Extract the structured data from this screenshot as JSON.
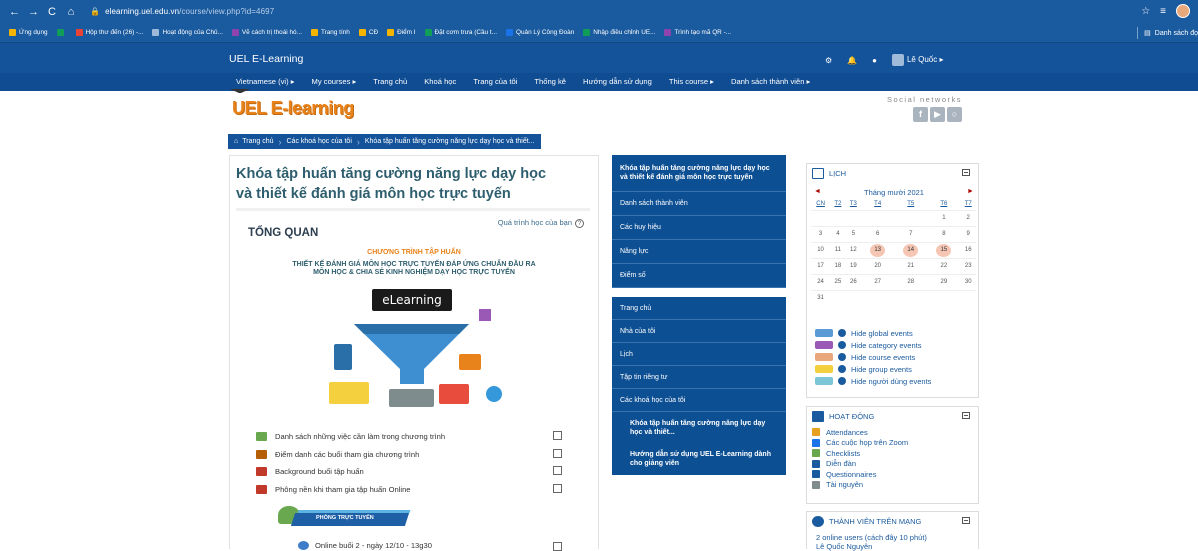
{
  "browser": {
    "url_host": "elearning.uel.edu.vn",
    "url_path": "/course/view.php?id=4697",
    "bookmarks": [
      {
        "label": "Ứng dụng",
        "color": "#f4b400"
      },
      {
        "label": "",
        "color": "#0f9d58"
      },
      {
        "label": "Hộp thư đến (26) -...",
        "color": "#ea4335"
      },
      {
        "label": "Hoạt động của Chủ...",
        "color": "#9fb9d8"
      },
      {
        "label": "Vẽ cách trị thoái hó...",
        "color": "#8e44ad"
      },
      {
        "label": "Trang tính",
        "color": "#f4b400"
      },
      {
        "label": "CĐ",
        "color": "#f4b400"
      },
      {
        "label": "Điểm I",
        "color": "#f4b400"
      },
      {
        "label": "Đặt cơm trưa (Cầu t...",
        "color": "#0f9d58"
      },
      {
        "label": "Quản Lý Công Đoàn",
        "color": "#1a73e8"
      },
      {
        "label": "Nhập điều chỉnh UE...",
        "color": "#0f9d58"
      },
      {
        "label": "Trình tạo mã QR -...",
        "color": "#8e44ad"
      }
    ],
    "bookmark_list_label": "Danh sách đọ"
  },
  "site": {
    "name": "UEL E-Learning",
    "user_name": "Lê Quốc",
    "menu": [
      "Vietnamese (vi) ▸",
      "My courses ▸",
      "Trang chủ",
      "Khoá học",
      "Trang của tôi",
      "Thống kê",
      "Hướng dẫn sử dụng",
      "This course ▸",
      "Danh sách thành viên ▸"
    ],
    "logo": "UEL E-learning",
    "social_label": "Social networks"
  },
  "breadcrumb": [
    "Trang chủ",
    "Các khoá học của tôi",
    "Khóa tập huấn tăng cường năng lực dạy học và thiết..."
  ],
  "course": {
    "title": "Khóa tập huấn tăng cường năng lực dạy học và thiết kế đánh giá môn học trực tuyến",
    "progress_label": "Quá trình học của bạn",
    "overview": "TỔNG QUAN",
    "program_title": "CHƯƠNG TRÌNH TẬP HUẤN",
    "program_sub_1": "THIẾT KẾ ĐÁNH GIÁ MÔN HỌC TRỰC TUYẾN ĐÁP ỨNG CHUẨN ĐẦU RA",
    "program_sub_2": "MÔN HỌC & CHIA SẺ KINH NGHIỆM DẠY HỌC TRỰC TUYẾN",
    "illus_label": "eLearning",
    "activities": [
      "Danh sách những việc cần làm trong chương trình",
      "Điểm danh các buổi tham gia chương trình",
      "Background buổi tập huấn",
      "Phông nền khi tham gia tập huấn Online"
    ],
    "live_banner": "PHÒNG TRỰC TUYẾN",
    "online_row": "Online buổi 2 - ngày 12/10 - 13g30"
  },
  "nav1": {
    "current": "Khóa tập huấn tăng cường năng lực dạy học và thiết kế đánh giá môn học trực tuyến",
    "items": [
      "Danh sách thành viên",
      "Các huy hiệu",
      "Năng lực",
      "Điểm số"
    ]
  },
  "nav2": {
    "items": [
      "Trang chủ",
      "Nhà của tôi",
      "Lịch",
      "Tập tin riêng tư",
      "Các khoá học của tôi"
    ],
    "sub_items": [
      "Khóa tập huấn tăng cường năng lực dạy học và thiết...",
      "Hướng dẫn sử dụng UEL E-Learning dành cho giảng viên"
    ]
  },
  "calendar": {
    "title": "LỊCH",
    "month": "Tháng mười 2021",
    "weekdays": [
      "CN",
      "T2",
      "T3",
      "T4",
      "T5",
      "T6",
      "T7"
    ],
    "weeks": [
      [
        "",
        "",
        "",
        "",
        "",
        "1",
        "2"
      ],
      [
        "3",
        "4",
        "5",
        "6",
        "7",
        "8",
        "9"
      ],
      [
        "10",
        "11",
        "12",
        "13",
        "14",
        "15",
        "16"
      ],
      [
        "17",
        "18",
        "19",
        "20",
        "21",
        "22",
        "23"
      ],
      [
        "24",
        "25",
        "26",
        "27",
        "28",
        "29",
        "30"
      ],
      [
        "31",
        "",
        "",
        "",
        "",
        "",
        ""
      ]
    ],
    "highlighted_days": [
      "13",
      "14",
      "15"
    ],
    "events": [
      {
        "label": "Hide global events",
        "color": "#5b9bd5"
      },
      {
        "label": "Hide category events",
        "color": "#9b59b6"
      },
      {
        "label": "Hide course events",
        "color": "#e8a87c"
      },
      {
        "label": "Hide group events",
        "color": "#f4d03f"
      },
      {
        "label": "Hide người dùng events",
        "color": "#7dc6d8"
      }
    ]
  },
  "activity_block": {
    "title": "HOẠT ĐỘNG",
    "items": [
      "Attendances",
      "Các cuộc họp trên Zoom",
      "Checklists",
      "Diễn đàn",
      "Questionnaires",
      "Tài nguyên"
    ]
  },
  "users_block": {
    "title": "THÀNH VIÊN TRÊN MẠNG",
    "text": "2 online users (cách đây 10 phút)",
    "user": "Lê Quốc Nguyên"
  }
}
